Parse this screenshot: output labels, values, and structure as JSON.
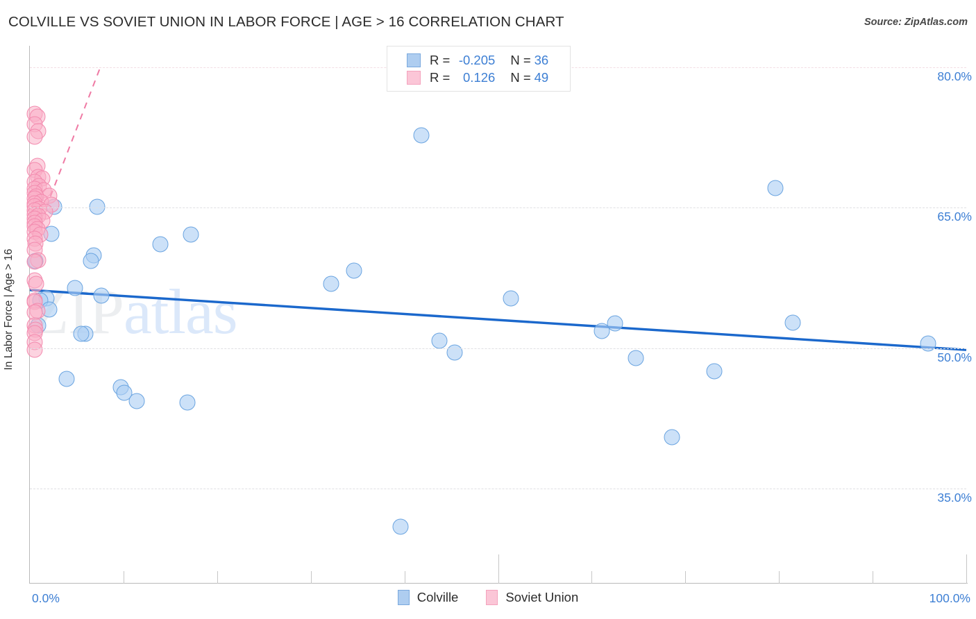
{
  "header": {
    "title": "COLVILLE VS SOVIET UNION IN LABOR FORCE | AGE > 16 CORRELATION CHART",
    "source": "Source: ZipAtlas.com"
  },
  "watermark": {
    "part1": "ZIP",
    "part2": "atlas"
  },
  "stats": {
    "blue": {
      "r_label": "R =",
      "r_value": "-0.205",
      "n_label": "N =",
      "n_value": "36"
    },
    "pink": {
      "r_label": "R =",
      "r_value": "0.126",
      "n_label": "N =",
      "n_value": "49"
    }
  },
  "legend": {
    "items": [
      {
        "label": "Colville",
        "color": "#aecdf0",
        "icon": "blue-square-swatch"
      },
      {
        "label": "Soviet Union",
        "color": "#fbc6d7",
        "icon": "pink-square-swatch"
      }
    ]
  },
  "chart_data": {
    "type": "scatter",
    "title": "COLVILLE VS SOVIET UNION IN LABOR FORCE | AGE > 16 CORRELATION CHART",
    "xlabel": "",
    "ylabel": "In Labor Force | Age > 16",
    "xlim": [
      0,
      100
    ],
    "ylim": [
      24.9,
      82.3
    ],
    "grid": true,
    "legend_position": "bottom-center",
    "x_tick_labels": [
      "0.0%",
      "100.0%"
    ],
    "x_tick_values": [
      0,
      100
    ],
    "x_minor_ticks": [
      10,
      20,
      30,
      40,
      50,
      60,
      70,
      80,
      90,
      100
    ],
    "y_tick_labels": [
      "80.0%",
      "65.0%",
      "50.0%",
      "35.0%"
    ],
    "y_tick_values": [
      80,
      65,
      50,
      35
    ],
    "series": [
      {
        "name": "Colville",
        "color": "#aecdf0",
        "edge_color": "#6aa4e0",
        "r": -0.205,
        "n": 36,
        "trendline": {
          "x0": 0,
          "y0": 56.2,
          "x1": 100,
          "y1": 49.8,
          "style": "solid",
          "color": "#1b68cc"
        },
        "points": [
          {
            "x": 2.6,
            "y": 65.1
          },
          {
            "x": 7.2,
            "y": 65.1
          },
          {
            "x": 2.3,
            "y": 62.2
          },
          {
            "x": 13.9,
            "y": 61.1
          },
          {
            "x": 17.2,
            "y": 62.1
          },
          {
            "x": 6.8,
            "y": 59.9
          },
          {
            "x": 6.5,
            "y": 59.3
          },
          {
            "x": 0.6,
            "y": 59.3
          },
          {
            "x": 34.6,
            "y": 58.3
          },
          {
            "x": 32.2,
            "y": 56.9
          },
          {
            "x": 41.8,
            "y": 72.7
          },
          {
            "x": 4.8,
            "y": 56.4
          },
          {
            "x": 51.4,
            "y": 55.3
          },
          {
            "x": 79.6,
            "y": 67.1
          },
          {
            "x": 7.6,
            "y": 55.6
          },
          {
            "x": 1.8,
            "y": 55.3
          },
          {
            "x": 1.1,
            "y": 55.1
          },
          {
            "x": 2.1,
            "y": 54.1
          },
          {
            "x": 62.5,
            "y": 52.6
          },
          {
            "x": 81.5,
            "y": 52.7
          },
          {
            "x": 61.1,
            "y": 51.8
          },
          {
            "x": 0.9,
            "y": 52.4
          },
          {
            "x": 5.9,
            "y": 51.5
          },
          {
            "x": 5.5,
            "y": 51.5
          },
          {
            "x": 95.9,
            "y": 50.5
          },
          {
            "x": 43.7,
            "y": 50.8
          },
          {
            "x": 45.4,
            "y": 49.5
          },
          {
            "x": 64.7,
            "y": 48.9
          },
          {
            "x": 3.9,
            "y": 46.7
          },
          {
            "x": 73.1,
            "y": 47.5
          },
          {
            "x": 9.7,
            "y": 45.8
          },
          {
            "x": 10.1,
            "y": 45.2
          },
          {
            "x": 11.4,
            "y": 44.3
          },
          {
            "x": 16.8,
            "y": 44.2
          },
          {
            "x": 68.6,
            "y": 40.5
          },
          {
            "x": 39.6,
            "y": 30.9
          }
        ]
      },
      {
        "name": "Soviet Union",
        "color": "#fbc6d7",
        "edge_color": "#f38aae",
        "r": 0.126,
        "n": 49,
        "trendline": {
          "x0": 2.2,
          "y0": 66.2,
          "x1": 7.6,
          "y1": 80.2,
          "style": "dashed",
          "color": "#ef7aa4"
        },
        "points": [
          {
            "x": 0.5,
            "y": 75.0
          },
          {
            "x": 0.8,
            "y": 74.7
          },
          {
            "x": 0.5,
            "y": 73.9
          },
          {
            "x": 0.9,
            "y": 73.2
          },
          {
            "x": 0.5,
            "y": 72.6
          },
          {
            "x": 0.8,
            "y": 69.5
          },
          {
            "x": 0.5,
            "y": 69.0
          },
          {
            "x": 0.9,
            "y": 68.3
          },
          {
            "x": 1.3,
            "y": 68.1
          },
          {
            "x": 0.5,
            "y": 67.8
          },
          {
            "x": 1.0,
            "y": 67.3
          },
          {
            "x": 0.5,
            "y": 67.0
          },
          {
            "x": 1.5,
            "y": 66.9
          },
          {
            "x": 0.5,
            "y": 66.6
          },
          {
            "x": 2.1,
            "y": 66.3
          },
          {
            "x": 0.7,
            "y": 66.2
          },
          {
            "x": 0.5,
            "y": 66.0
          },
          {
            "x": 1.2,
            "y": 65.6
          },
          {
            "x": 0.5,
            "y": 65.5
          },
          {
            "x": 2.3,
            "y": 65.3
          },
          {
            "x": 0.5,
            "y": 65.2
          },
          {
            "x": 1.0,
            "y": 64.9
          },
          {
            "x": 0.5,
            "y": 64.7
          },
          {
            "x": 1.6,
            "y": 64.6
          },
          {
            "x": 0.5,
            "y": 64.3
          },
          {
            "x": 0.9,
            "y": 64.1
          },
          {
            "x": 0.5,
            "y": 63.8
          },
          {
            "x": 1.3,
            "y": 63.6
          },
          {
            "x": 0.5,
            "y": 63.4
          },
          {
            "x": 0.5,
            "y": 63.0
          },
          {
            "x": 0.8,
            "y": 62.7
          },
          {
            "x": 0.5,
            "y": 62.4
          },
          {
            "x": 1.1,
            "y": 62.1
          },
          {
            "x": 0.5,
            "y": 61.7
          },
          {
            "x": 0.6,
            "y": 61.2
          },
          {
            "x": 0.5,
            "y": 60.5
          },
          {
            "x": 0.9,
            "y": 59.4
          },
          {
            "x": 0.5,
            "y": 59.2
          },
          {
            "x": 0.5,
            "y": 57.2
          },
          {
            "x": 0.7,
            "y": 56.9
          },
          {
            "x": 0.5,
            "y": 55.1
          },
          {
            "x": 0.5,
            "y": 54.9
          },
          {
            "x": 0.8,
            "y": 54.0
          },
          {
            "x": 0.5,
            "y": 53.8
          },
          {
            "x": 0.5,
            "y": 52.4
          },
          {
            "x": 0.6,
            "y": 52.0
          },
          {
            "x": 0.5,
            "y": 51.6
          },
          {
            "x": 0.5,
            "y": 50.6
          },
          {
            "x": 0.5,
            "y": 49.8
          }
        ]
      }
    ]
  }
}
